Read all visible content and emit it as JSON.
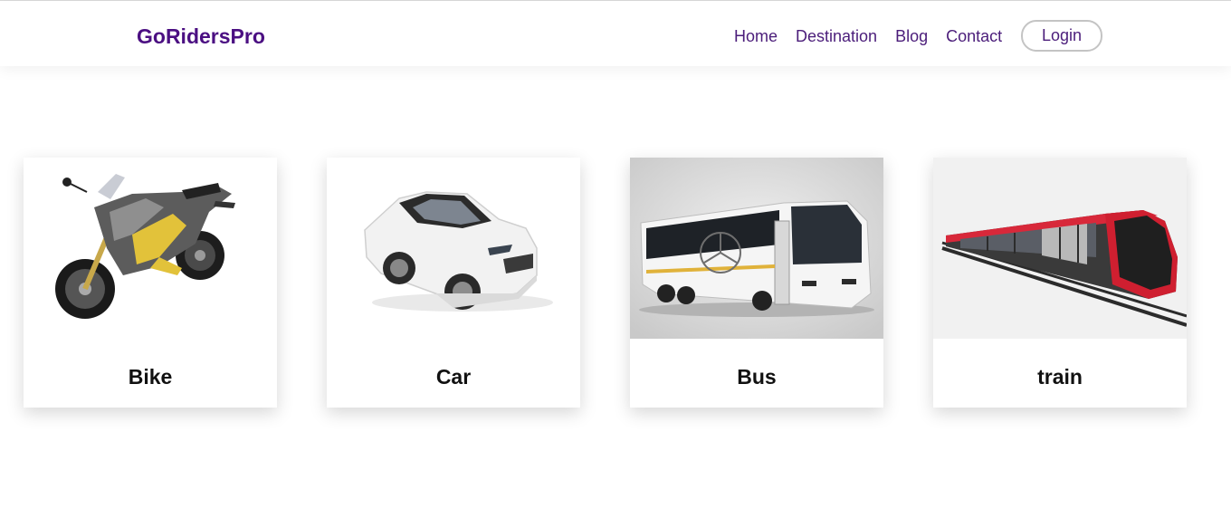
{
  "navbar": {
    "brand": "GoRidersPro",
    "links": [
      "Home",
      "Destination",
      "Blog",
      "Contact"
    ],
    "login_label": "Login"
  },
  "colors": {
    "brand": "#4b0f82",
    "nav_text": "#4b1d7a",
    "card_title": "#111111"
  },
  "cards": [
    {
      "title": "Bike",
      "image": "motorcycle-image"
    },
    {
      "title": "Car",
      "image": "car-image"
    },
    {
      "title": "Bus",
      "image": "bus-image"
    },
    {
      "title": "train",
      "image": "train-image"
    }
  ]
}
